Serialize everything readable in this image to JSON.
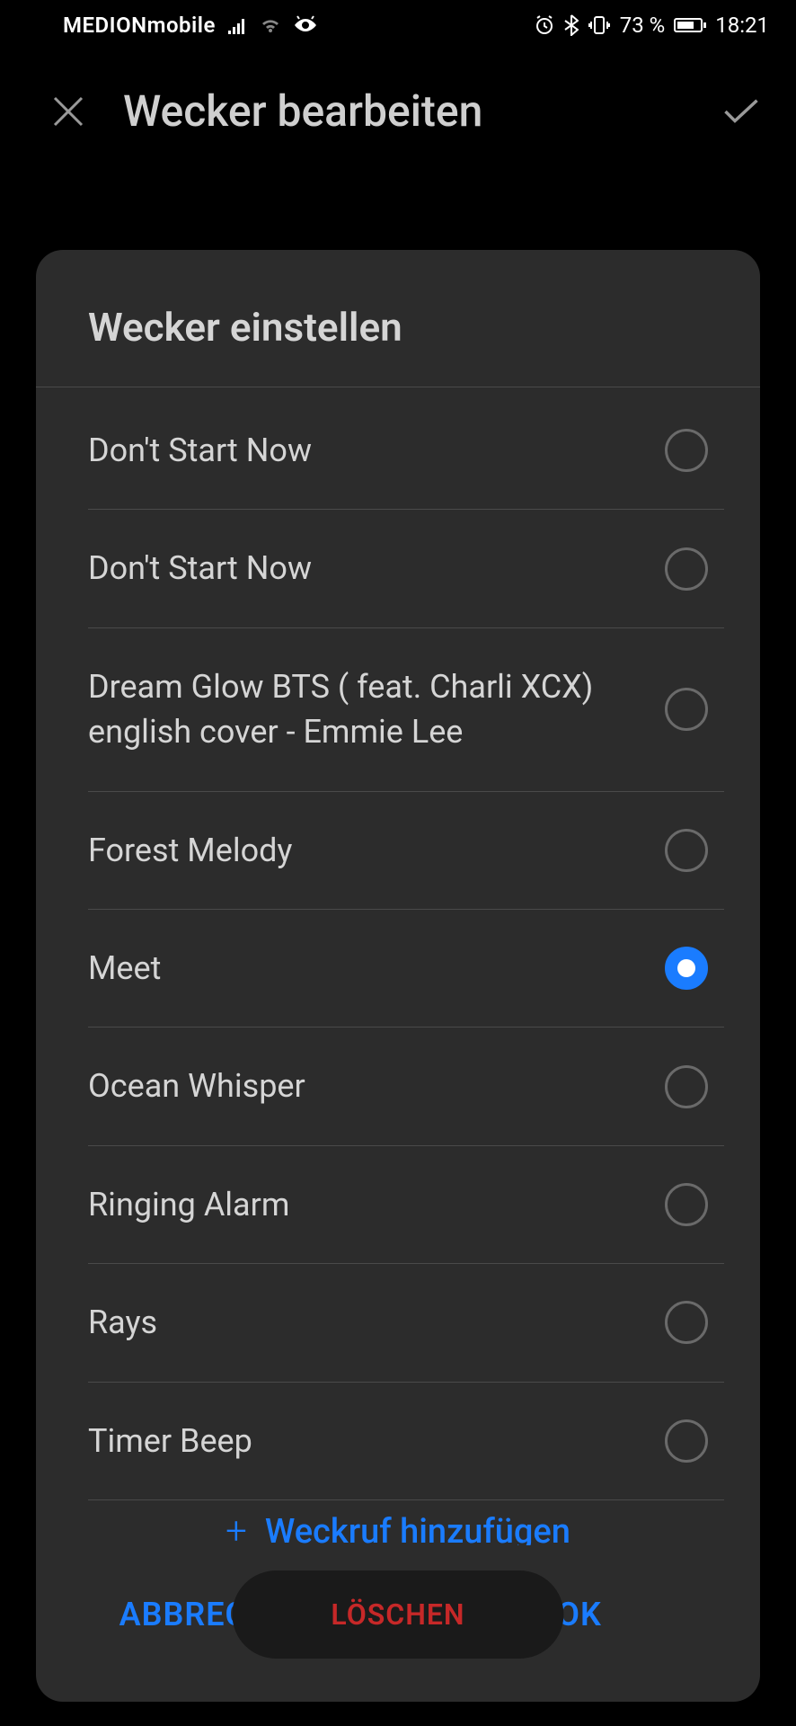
{
  "statusBar": {
    "carrier": "MEDIONmobile",
    "battery": "73 %",
    "time": "18:21"
  },
  "header": {
    "title": "Wecker bearbeiten"
  },
  "dialog": {
    "title": "Wecker einstellen",
    "sounds": [
      {
        "label": "Don't Start Now",
        "selected": false
      },
      {
        "label": "Don't Start Now",
        "selected": false
      },
      {
        "label": "Dream Glow  BTS ( feat. Charli XCX) english cover - Emmie Lee",
        "selected": false
      },
      {
        "label": "Forest Melody",
        "selected": false
      },
      {
        "label": "Meet",
        "selected": true
      },
      {
        "label": "Ocean Whisper",
        "selected": false
      },
      {
        "label": "Ringing Alarm",
        "selected": false
      },
      {
        "label": "Rays",
        "selected": false
      },
      {
        "label": "Timer Beep",
        "selected": false
      }
    ],
    "addRingtone": "Weckruf hinzufügen",
    "cancelBtn": "ABBRECHEN",
    "okBtn": "OK"
  },
  "deleteBtn": "LÖSCHEN"
}
